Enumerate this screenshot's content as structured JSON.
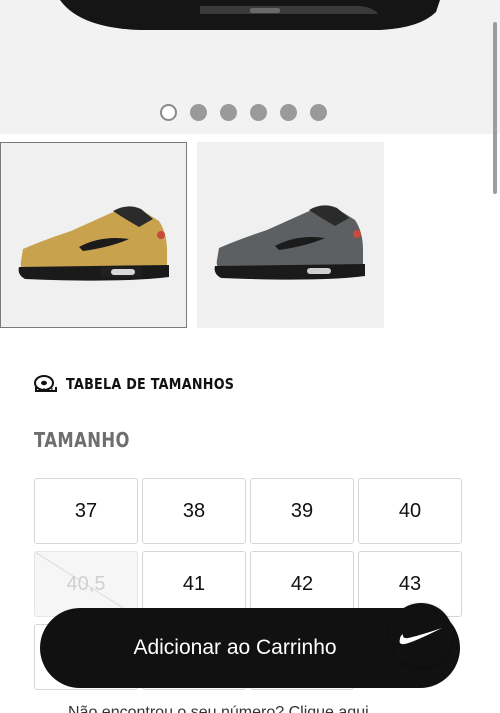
{
  "gallery": {
    "slide_count": 6,
    "active_slide": 1,
    "thumbnails": [
      {
        "colorway": "wheat-black",
        "selected": true,
        "upper": "#c9a24e",
        "sole": "#1a1a1a",
        "accent": "#c84a3a"
      },
      {
        "colorway": "grey-black",
        "selected": false,
        "upper": "#5c6062",
        "sole": "#1a1a1a",
        "accent": "#c84a3a"
      }
    ]
  },
  "size_guide": {
    "label": "TABELA DE TAMANHOS",
    "icon": "measuring-tape-icon"
  },
  "size_section": {
    "heading": "TAMANHO"
  },
  "sizes": [
    {
      "label": "37",
      "available": true
    },
    {
      "label": "38",
      "available": true
    },
    {
      "label": "39",
      "available": true
    },
    {
      "label": "40",
      "available": true
    },
    {
      "label": "40,5",
      "available": false
    },
    {
      "label": "41",
      "available": true
    },
    {
      "label": "42",
      "available": true
    },
    {
      "label": "43",
      "available": true
    },
    {
      "label": "",
      "available": true
    },
    {
      "label": "",
      "available": true
    },
    {
      "label": "",
      "available": true
    }
  ],
  "cart": {
    "label": "Adicionar ao Carrinho"
  },
  "fab": {
    "icon": "nike-swoosh-icon"
  },
  "footer": {
    "text": "Não encontrou o seu número? Clique aqui"
  },
  "colors": {
    "primary": "#111111",
    "background": "#ffffff",
    "hero_bg": "#f2f2f2",
    "muted": "#6e6e6e"
  }
}
